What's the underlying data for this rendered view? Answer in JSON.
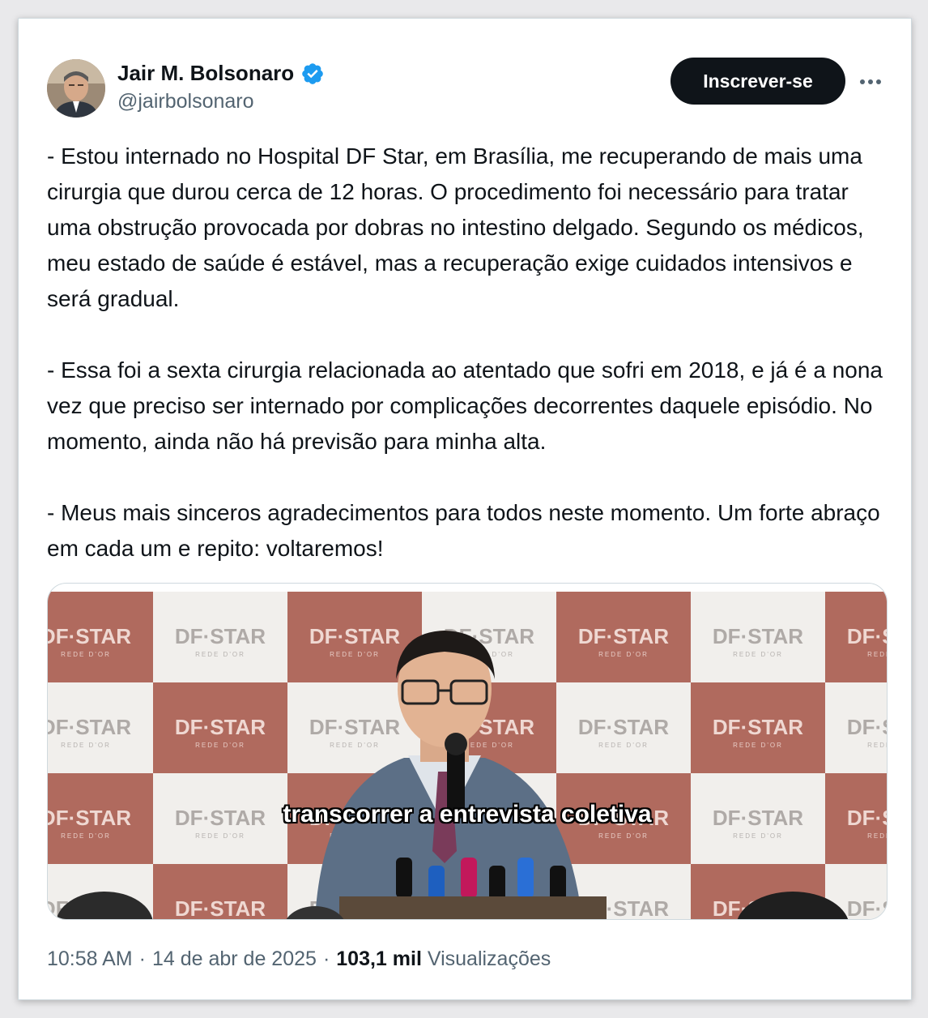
{
  "author": {
    "name": "Jair M. Bolsonaro",
    "handle": "@jairbolsonaro",
    "verified": true,
    "avatar_icon": "profile-photo"
  },
  "actions": {
    "subscribe_label": "Inscrever-se",
    "more_icon": "more-horizontal-icon"
  },
  "tweet": {
    "paragraphs": [
      "- Estou internado no Hospital DF Star, em Brasília, me recuperando de mais uma cirurgia que durou cerca de 12 horas. O procedimento foi necessário para tratar uma obstrução provocada por dobras no intestino delgado. Segundo os médicos, meu estado de saúde é estável, mas a recuperação exige cuidados intensivos e será gradual.",
      "- Essa foi a sexta cirurgia relacionada ao atentado que sofri em 2018, e já é a nona vez que preciso ser internado por complicações decorrentes daquele episódio. No momento, ainda não há previsão para minha alta.",
      "- Meus mais sinceros agradecimentos para todos neste momento. Um forte abraço em cada um e repito: voltaremos!"
    ]
  },
  "media": {
    "caption": "transcorrer a entrevista coletiva",
    "backdrop_logo": "DF·STAR",
    "backdrop_sub": "REDE D'OR"
  },
  "meta": {
    "time": "10:58 AM",
    "separator": "·",
    "date": "14 de abr de 2025",
    "views_count": "103,1 mil",
    "views_label": "Visualizações"
  },
  "colors": {
    "text": "#0f1419",
    "secondary": "#536471",
    "verified": "#1d9bf0",
    "button_bg": "#0f1419",
    "backdrop_brown": "#b06a5e",
    "backdrop_white": "#f1efec"
  }
}
